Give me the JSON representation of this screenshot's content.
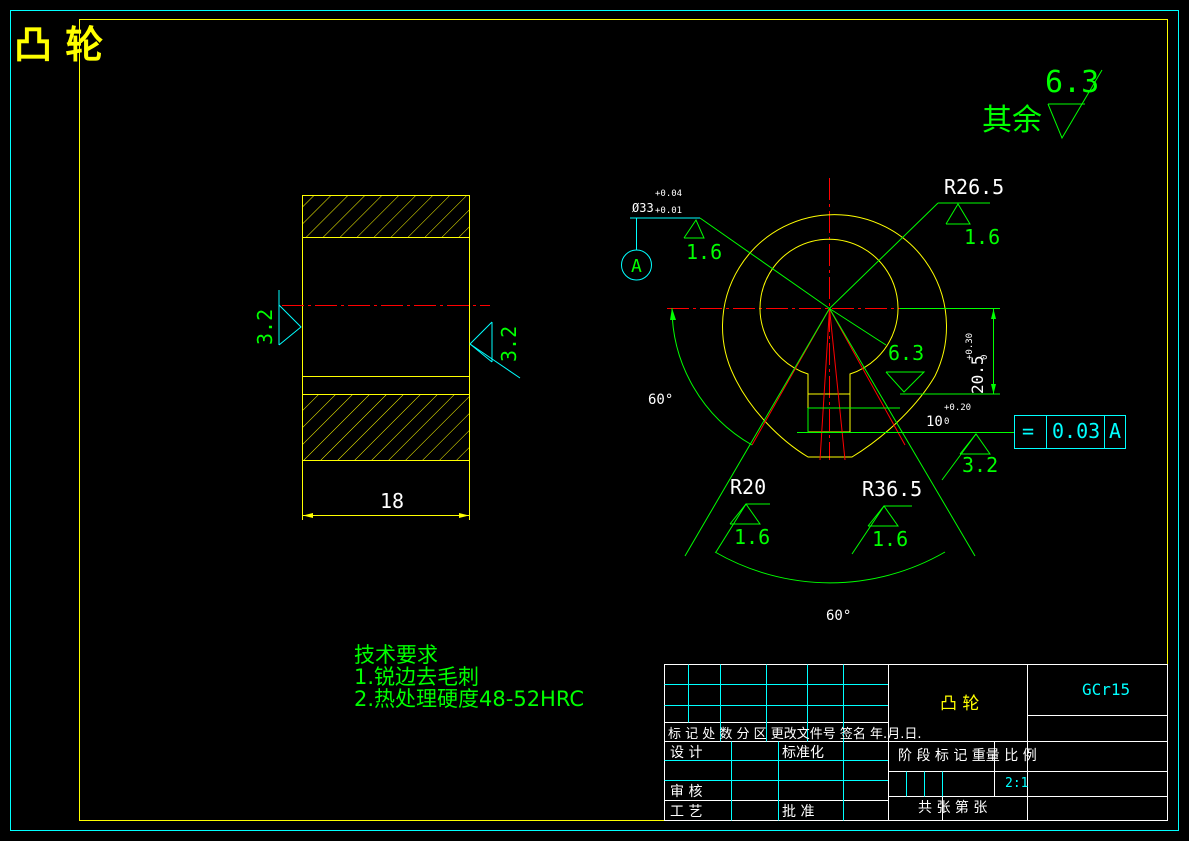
{
  "title": "凸 轮",
  "roughness": {
    "other_label": "其余",
    "other_value": "6.3",
    "side_left": "3.2",
    "side_right": "3.2",
    "bore": "1.6",
    "outer": "1.6",
    "keyway": "6.3",
    "slot_bottom": "3.2",
    "r20": "1.6",
    "r365": "1.6"
  },
  "dimensions": {
    "width": "18",
    "bore_dia": "Ø33",
    "bore_tol_upper": "+0.04",
    "bore_tol_lower": "+0.01",
    "r_outer": "R26.5",
    "r_left": "R20",
    "r_right": "R36.5",
    "angle_left": "60°",
    "angle_bottom": "60°",
    "key_depth": "20.5",
    "key_depth_tol_upper": "+0.30",
    "key_depth_tol_lower": "0",
    "key_width": "10",
    "key_width_tol_upper": "+0.20",
    "key_width_tol_lower": "0"
  },
  "datum": {
    "label": "A"
  },
  "tolerance_frame": {
    "symbol": "=",
    "value": "0.03",
    "datum": "A"
  },
  "tech_requirements": {
    "heading": "技术要求",
    "item1": "1.锐边去毛刺",
    "item2": "2.热处理硬度48-52HRC"
  },
  "title_block": {
    "part_name": "凸  轮",
    "material": "GCr15",
    "header_row": "标 记 处 数 分  区 更改文件号 签名 年.月.日.",
    "design": "设 计",
    "standardize": "标准化",
    "review": "审 核",
    "process": "工 艺",
    "approve": "批 准",
    "stage_labels": "阶 段 标 记  重量 比 例",
    "scale": "2:1",
    "sheet_info": "共   张  第    张"
  }
}
